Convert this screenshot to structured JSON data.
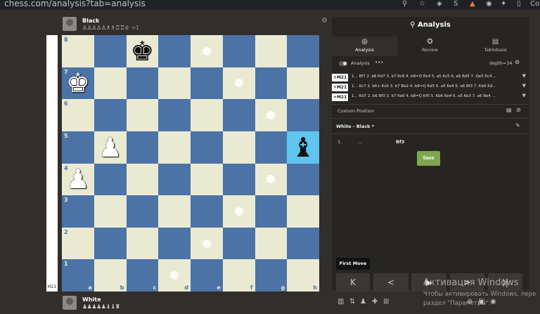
{
  "browser": {
    "url": "chess.com/analysis?tab=analysis",
    "icons": [
      "search-icon",
      "star-icon",
      "ext-1-icon",
      "ext-2-icon",
      "ext-3-icon",
      "ext-4-icon",
      "puzzle-icon",
      "sidebar-icon",
      "profile-icon"
    ],
    "profile_label": "Co"
  },
  "top_player": {
    "name": "Black",
    "captured": "♙♙♙♙♙♗♗♖♖♕",
    "advantage": "+1"
  },
  "bottom_player": {
    "name": "White",
    "captured": "♟♟♟♟♟♝♝♜"
  },
  "eval_label": "M21",
  "board": {
    "ranks": [
      "8",
      "7",
      "6",
      "5",
      "4",
      "3",
      "2",
      "1"
    ],
    "files": [
      "a",
      "b",
      "c",
      "d",
      "e",
      "f",
      "g",
      "h"
    ],
    "pieces": [
      {
        "square": "c8",
        "glyph": "♚",
        "color": "black"
      },
      {
        "square": "a7",
        "glyph": "♚",
        "color": "white"
      },
      {
        "square": "b5",
        "glyph": "♟",
        "color": "white"
      },
      {
        "square": "a4",
        "glyph": "♟",
        "color": "white"
      },
      {
        "square": "h5",
        "glyph": "♝",
        "color": "black"
      }
    ],
    "dots": [
      "e8",
      "f7",
      "g6",
      "g4",
      "f3",
      "e2",
      "d1"
    ],
    "highlight": [
      "h5"
    ]
  },
  "panel": {
    "title": "Analysis",
    "tabs": [
      {
        "label": "Analysis",
        "icon": "◎",
        "active": true
      },
      {
        "label": "Review",
        "icon": "✪",
        "active": false
      },
      {
        "label": "Tablebase",
        "icon": "▤",
        "active": false
      }
    ],
    "engine_label": "Analysis",
    "engine_more": "•••",
    "depth": "depth=34",
    "lines": [
      {
        "score": "+M21",
        "moves": "1... Bf7 2. b6 Kd7 3. b7 Kc6 4. b8=Q Bc4 5. a5 Kc5 6. a6 Bd5 7. Qe5 Kc4 ..."
      },
      {
        "score": "+M21",
        "moves": "1... Kc7 2. b6+ Kc6 3. b7 Be2 4. b8=Q Kd5 5. a5 Ke4 6. a6 Bf3 7. Kb6 Kd..."
      },
      {
        "score": "+M21",
        "moves": "1... Kd7 2. b6 Bf3 3. b7 Ke6 4. b8=Q Kf5 5. Kb6 Ke4 6. a5 Ke3 7. a6 Be4 ..."
      }
    ],
    "custom_position": "Custom Position",
    "game_title": "White - Black *",
    "move_number": "1.",
    "move_ellipsis": "...",
    "move_text": "Bf3",
    "save_label": "Save"
  },
  "tooltip": "First Move",
  "nav": [
    "K",
    "<",
    "▶",
    ">",
    "⟩|"
  ],
  "watermark": {
    "line1": "Активация Windows",
    "line2": "Чтобы активировать Windows, пере",
    "line3": "раздел \"Параметры\"."
  }
}
